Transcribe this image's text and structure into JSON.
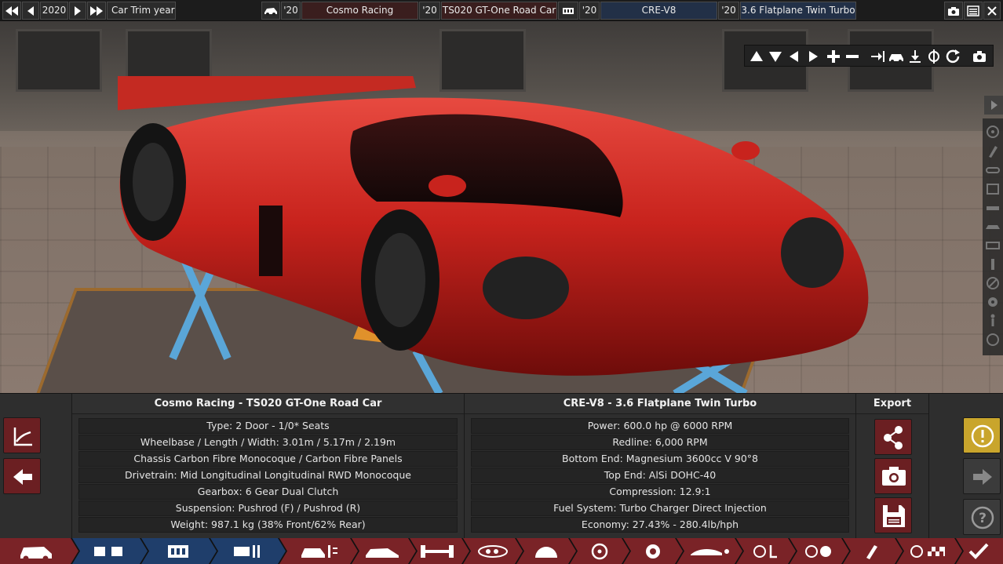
{
  "topbar": {
    "year": "2020",
    "trim_year_label": "Car Trim year",
    "model_year": "'20",
    "model_name": "Cosmo Racing",
    "trim_year": "'20",
    "trim_name": "TS020 GT-One Road Car",
    "engine_family_year": "'20",
    "engine_family": "CRE-V8",
    "engine_variant_year": "'20",
    "engine_variant": "3.6 Flatplane Twin Turbo"
  },
  "car_panel": {
    "title": "Cosmo Racing - TS020 GT-One Road Car",
    "rows": [
      "Type: 2 Door - 1/0* Seats",
      "Wheelbase / Length / Width: 3.01m / 5.17m / 2.19m",
      "Chassis Carbon Fibre Monocoque / Carbon Fibre Panels",
      "Drivetrain: Mid Longitudinal Longitudinal RWD Monocoque",
      "Gearbox: 6 Gear Dual Clutch",
      "Suspension: Pushrod (F) / Pushrod (R)",
      "Weight: 987.1 kg (38% Front/62% Rear)"
    ]
  },
  "engine_panel": {
    "title": "CRE-V8 - 3.6 Flatplane Twin Turbo",
    "rows": [
      "Power: 600.0 hp @ 6000 RPM",
      "Redline:  6,000 RPM",
      "Bottom End: Magnesium 3600cc V 90°8",
      "Top End: AlSi DOHC-40",
      "Compression: 12.9:1",
      "Fuel System: Turbo Charger Direct Injection",
      "Economy: 27.43% - 280.4lb/hph"
    ]
  },
  "export_panel": {
    "title": "Export"
  },
  "colors": {
    "accent_red": "#6b1f22",
    "warning_yellow": "#c9a52c",
    "nav_active": "#7a2327",
    "nav_blue": "#1f3e6b"
  },
  "icons": {
    "first": "double-left-arrow-icon",
    "prev": "left-arrow-icon",
    "next": "right-arrow-icon",
    "last": "double-right-arrow-icon",
    "car": "car-icon",
    "engine": "engine-icon",
    "camera": "camera-icon",
    "menu": "menu-icon",
    "warning": "exclamation-icon",
    "help": "question-icon",
    "share": "share-icon",
    "save": "save-icon",
    "back": "back-arrow-icon",
    "graph": "graph-icon",
    "confirm": "checkmark-icon"
  }
}
